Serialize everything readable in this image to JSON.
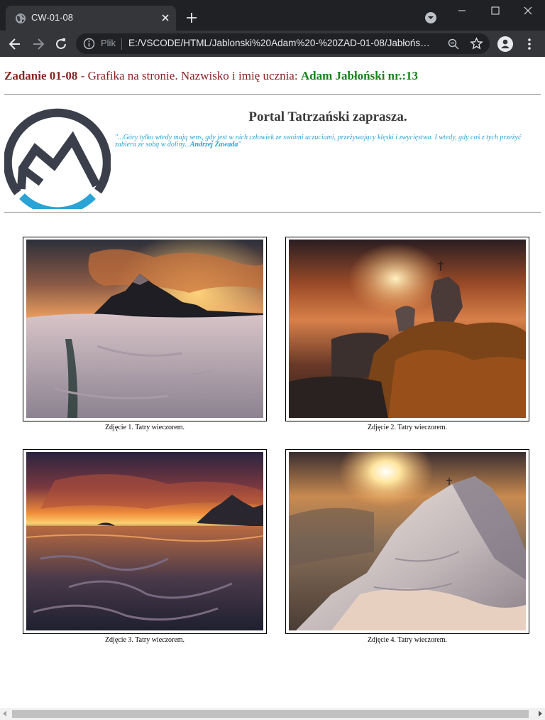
{
  "browser": {
    "tab_title": "CW-01-08",
    "scheme_label": "Plik",
    "url": "E:/VSCODE/HTML/Jablonski%20Adam%20-%20ZAD-01-08/Jabłoński...",
    "icons": [
      "globe-icon",
      "close-icon",
      "plus-icon",
      "tab-search-icon",
      "minimize-icon",
      "maximize-icon",
      "window-close-icon",
      "back-arrow-icon",
      "forward-arrow-icon",
      "reload-icon",
      "info-icon",
      "zoom-icon",
      "star-icon",
      "profile-icon",
      "more-vert-icon"
    ]
  },
  "page": {
    "task_label": "Zadanie 01-08",
    "task_desc": " - Grafika na stronie. Nazwisko i imię ucznia: ",
    "student": "Adam Jabłoński nr.:13",
    "portal_title": "Portal Tatrzański zaprasza.",
    "quote_text": "\"...Góry tylko wtedy mają sens, gdy jest w nich człowiek ze swoimi uczuciami, przeżywający klęski i zwycięstwa. I wtedy, gdy coś z tych przeżyć zabiera ze sobą w doliny...",
    "quote_author": "Andrzej Zawada",
    "quote_close": "\"",
    "colors": {
      "task": "#8b2323",
      "student": "#168318",
      "quote": "#2aa3d6",
      "logo_dark": "#3a3f4b",
      "logo_blue": "#2aa3d6"
    },
    "figures": [
      {
        "caption": "Zdjęcie 1. Tatry wieczorem."
      },
      {
        "caption": "Zdjęcie 2. Tatry wieczorem."
      },
      {
        "caption": "Zdjęcie 3. Tatry wieczorem."
      },
      {
        "caption": "Zdjęcie 4. Tatry wieczorem."
      }
    ]
  }
}
